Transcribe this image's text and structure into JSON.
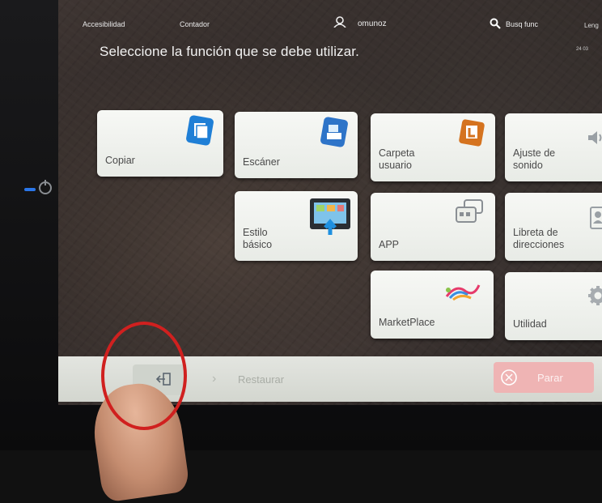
{
  "topbar": {
    "accessibility": "Accesibilidad",
    "counter": "Contador",
    "username": "omunoz",
    "search": "Busq func",
    "language": "Leng",
    "clock": "24 03"
  },
  "prompt": "Seleccione la función que se debe utilizar.",
  "tiles": [
    {
      "label": "Copiar",
      "icon": "copy-icon",
      "color": "#1f7fd6"
    },
    {
      "label": "Escáner",
      "icon": "scanner-icon",
      "color": "#2e74c8"
    },
    {
      "label": "Carpeta usuario",
      "icon": "user-box-icon",
      "color": "#d5731f"
    },
    {
      "label": "Ajuste de sonido",
      "icon": "speaker-icon",
      "color": "#8a8f94"
    },
    {
      "label": "Estilo básico",
      "icon": "basic-style-icon",
      "color": "#2a9ad8"
    },
    {
      "label": "APP",
      "icon": "app-icon",
      "color": "#8a8f94"
    },
    {
      "label": "Libreta de direcciones",
      "icon": "address-book-icon",
      "color": "#8a8f94"
    },
    {
      "label": "MarketPlace",
      "icon": "marketplace-icon",
      "color": "#e63b6b"
    },
    {
      "label": "Utilidad",
      "icon": "gear-icon",
      "color": "#8a8f94"
    }
  ],
  "bottombar": {
    "restore": "Restaurar",
    "stop": "Parar"
  },
  "colors": {
    "highlight_ring": "#d0201f",
    "stop_button": "#efb4b4",
    "power_led": "#2a76e8"
  }
}
